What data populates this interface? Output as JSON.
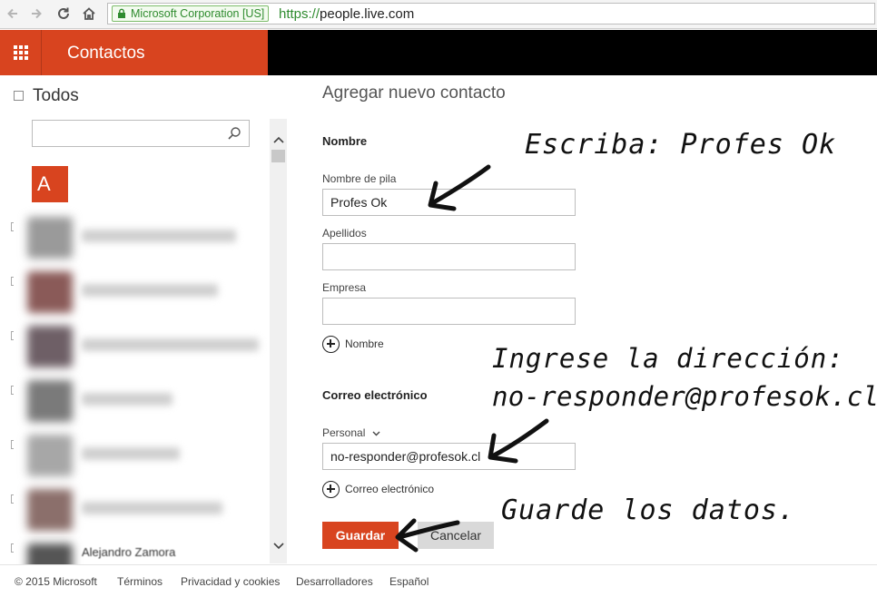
{
  "browser": {
    "ev_cert": "Microsoft Corporation [US]",
    "url_scheme": "https://",
    "url_host": "people.live.com"
  },
  "header": {
    "app_title": "Contactos",
    "accent": "#d8441f"
  },
  "left_panel": {
    "select_all_label": "Todos",
    "search_placeholder": "",
    "group_letter": "A",
    "last_visible_contact": "Alejandro Zamora"
  },
  "form": {
    "title": "Agregar nuevo contacto",
    "name_section": "Nombre",
    "first_name_label": "Nombre de pila",
    "first_name_value": "Profes Ok",
    "last_name_label": "Apellidos",
    "last_name_value": "",
    "company_label": "Empresa",
    "company_value": "",
    "add_name_label": "Nombre",
    "email_section": "Correo electrónico",
    "email_type_label": "Personal",
    "email_value": "no-responder@profesok.cl",
    "add_email_label": "Correo electrónico",
    "save_label": "Guardar",
    "cancel_label": "Cancelar"
  },
  "annotations": {
    "step1": "Escriba: Profes Ok",
    "step2_line1": "Ingrese la dirección:",
    "step2_line2": "no-responder@profesok.cl",
    "step3": "Guarde los datos."
  },
  "footer": {
    "copyright": "© 2015 Microsoft",
    "terms": "Términos",
    "privacy": "Privacidad y cookies",
    "developers": "Desarrolladores",
    "language": "Español"
  }
}
